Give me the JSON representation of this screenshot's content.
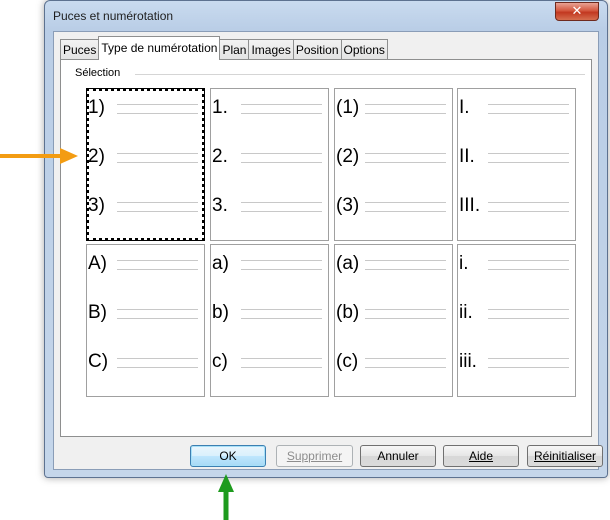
{
  "window": {
    "title": "Puces et numérotation",
    "close_symbol": "✕"
  },
  "tabs": [
    {
      "label": "Puces"
    },
    {
      "label": "Type de numérotation",
      "active": true
    },
    {
      "label": "Plan"
    },
    {
      "label": "Images"
    },
    {
      "label": "Position"
    },
    {
      "label": "Options"
    }
  ],
  "section": {
    "label": "Sélection"
  },
  "presets": [
    {
      "lines": [
        "1)",
        "2)",
        "3)"
      ],
      "selected": true
    },
    {
      "lines": [
        "1.",
        "2.",
        "3."
      ]
    },
    {
      "lines": [
        "(1)",
        "(2)",
        "(3)"
      ]
    },
    {
      "lines": [
        "I.",
        "II.",
        "III."
      ]
    },
    {
      "lines": [
        "A)",
        "B)",
        "C)"
      ]
    },
    {
      "lines": [
        "a)",
        "b)",
        "c)"
      ]
    },
    {
      "lines": [
        "(a)",
        "(b)",
        "(c)"
      ]
    },
    {
      "lines": [
        "i.",
        "ii.",
        "iii."
      ]
    }
  ],
  "buttons": {
    "ok": "OK",
    "supprimer": "Supprimer",
    "annuler": "Annuler",
    "aide": "Aide",
    "reinitialiser": "Réinitialiser"
  },
  "colors": {
    "orange_arrow": "#f39c12",
    "green_arrow": "#1e9b1e"
  }
}
